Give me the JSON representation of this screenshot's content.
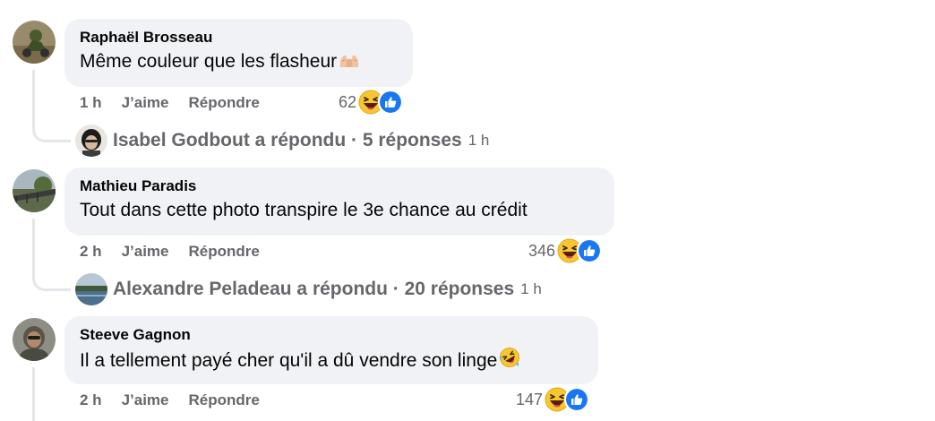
{
  "comments": [
    {
      "author": "Raphaël Brosseau",
      "text": "Même couleur que les flasheur",
      "text_emoji": "palms-up-together-emoji",
      "time": "1 h",
      "like_label": "J’aime",
      "reply_label": "Répondre",
      "reaction_count": "62",
      "reply_summary": {
        "text": "Isabel Godbout a répondu · 5 réponses",
        "time": "1 h"
      }
    },
    {
      "author": "Mathieu Paradis",
      "text": "Tout dans cette photo transpire le 3e chance au crédit",
      "time": "2 h",
      "like_label": "J’aime",
      "reply_label": "Répondre",
      "reaction_count": "346",
      "reply_summary": {
        "text": "Alexandre Peladeau a répondu · 20 réponses",
        "time": "1 h"
      }
    },
    {
      "author": "Steeve Gagnon",
      "text": "Il a tellement payé cher qu'il a dû vendre son linge",
      "text_emoji": "rolling-laughing-emoji",
      "time": "2 h",
      "like_label": "J’aime",
      "reply_label": "Répondre",
      "reaction_count": "147"
    }
  ],
  "colors": {
    "bubble": "#f0f2f5",
    "secondary_text": "#65676b",
    "like_blue": "#1877f2",
    "haha_yellow": "#f7c631",
    "thread_line": "#e4e6eb"
  }
}
